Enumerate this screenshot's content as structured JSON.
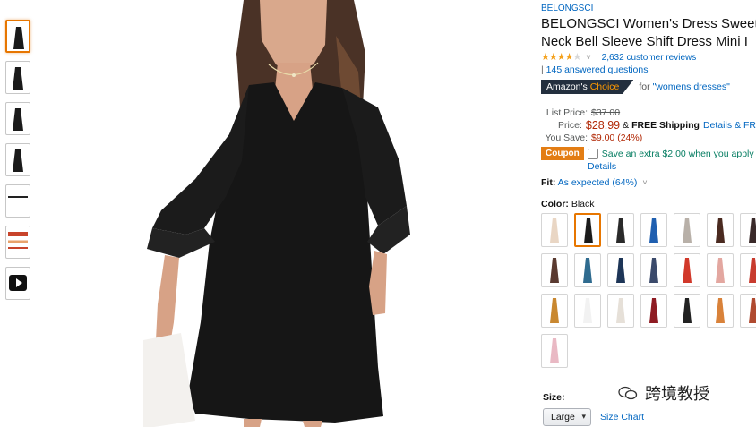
{
  "product": {
    "brand": "BELONGSCI",
    "title_line1": "BELONGSCI Women's Dress Sweet",
    "title_line2": "Neck Bell Sleeve Shift Dress Mini I",
    "rating_value": 4.3,
    "reviews": "2,632 customer reviews",
    "answered_questions": "145 answered questions",
    "qa_separator": "|",
    "badge_prefix": "Amazon's",
    "badge_choice": "Choice",
    "badge_for": "for",
    "badge_query": "\"womens dresses\""
  },
  "pricing": {
    "list_label": "List Price:",
    "list_price": "$37.00",
    "price_label": "Price:",
    "price": "$28.99",
    "amp": "&",
    "free_shipping": "FREE Shipping",
    "details": "Details",
    "amp2": "& FR",
    "save_label": "You Save:",
    "save_value": "$9.00 (24%)"
  },
  "coupon": {
    "badge": "Coupon",
    "text": "Save an extra $2.00 when you apply",
    "details": "Details"
  },
  "fit": {
    "label": "Fit:",
    "value": "As expected (64%)"
  },
  "color": {
    "label": "Color:",
    "value": "Black",
    "swatch_colors": [
      "#e9d6c4",
      "#1b1b1b",
      "#2a2a2a",
      "#1f5fb0",
      "#b8b0a8",
      "#4a2a20",
      "#3a2a2a",
      "#5a3a30",
      "#2f6b8f",
      "#1d3557",
      "#3b4a6b",
      "#d1382a",
      "#e3a7a0",
      "#c83b2e",
      "#c98830",
      "#f2f2f2",
      "#e6e0d8",
      "#8e1b22",
      "#222222",
      "#d9823a",
      "#b04a30",
      "#e9b9c4"
    ],
    "selected_index": 1
  },
  "size": {
    "label": "Size:",
    "selected": "Large",
    "chart_link": "Size Chart"
  },
  "watermark": {
    "text": "跨境教授"
  }
}
